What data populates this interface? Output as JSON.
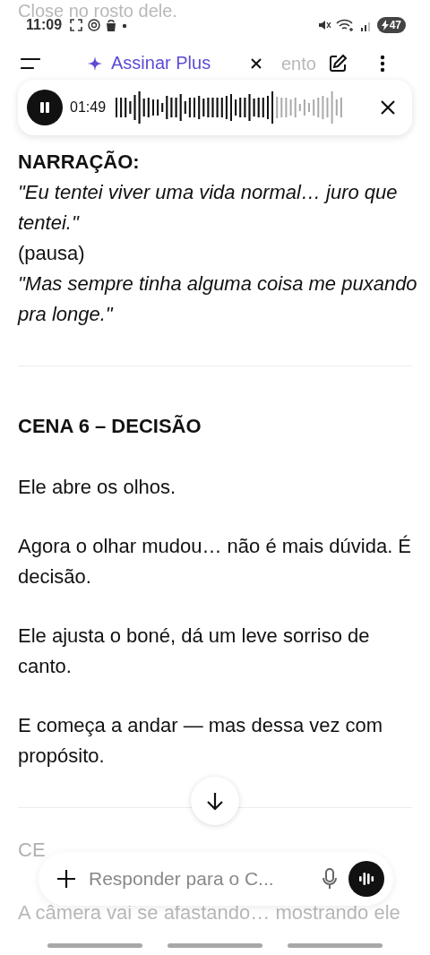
{
  "status_bar": {
    "time": "11:09",
    "battery": "47"
  },
  "background_text": {
    "top": "Close no rosto dele.",
    "behind_header": "ento"
  },
  "header": {
    "upgrade_label": "Assinar Plus"
  },
  "audio_player": {
    "playing": true,
    "elapsed": "01:49",
    "level": 0.69
  },
  "content": [
    {
      "kind": "heading",
      "text": "NARRAÇÃO:"
    },
    {
      "kind": "quote",
      "text": "\"Eu tentei viver uma vida normal… juro que tentei.\""
    },
    {
      "kind": "plain",
      "text": "(pausa)"
    },
    {
      "kind": "quote",
      "text": "\"Mas sempre tinha alguma coisa me puxando pra longe.\""
    },
    {
      "kind": "divider"
    },
    {
      "kind": "heading",
      "text": "CENA 6 – DECISÃO"
    },
    {
      "kind": "paragraph",
      "text": "Ele abre os olhos."
    },
    {
      "kind": "paragraph",
      "text": "Agora o olhar mudou… não é mais dúvida. É decisão."
    },
    {
      "kind": "paragraph",
      "text": "Ele ajusta o boné, dá um leve sorriso de canto."
    },
    {
      "kind": "paragraph",
      "text": "E começa a andar — mas dessa vez com propósito."
    },
    {
      "kind": "divider"
    },
    {
      "kind": "faded",
      "text": "CE"
    },
    {
      "kind": "faded_bottom",
      "text": "A câmera vai se afastando… mostrando ele"
    }
  ],
  "composer": {
    "placeholder": "Responder para o C..."
  }
}
